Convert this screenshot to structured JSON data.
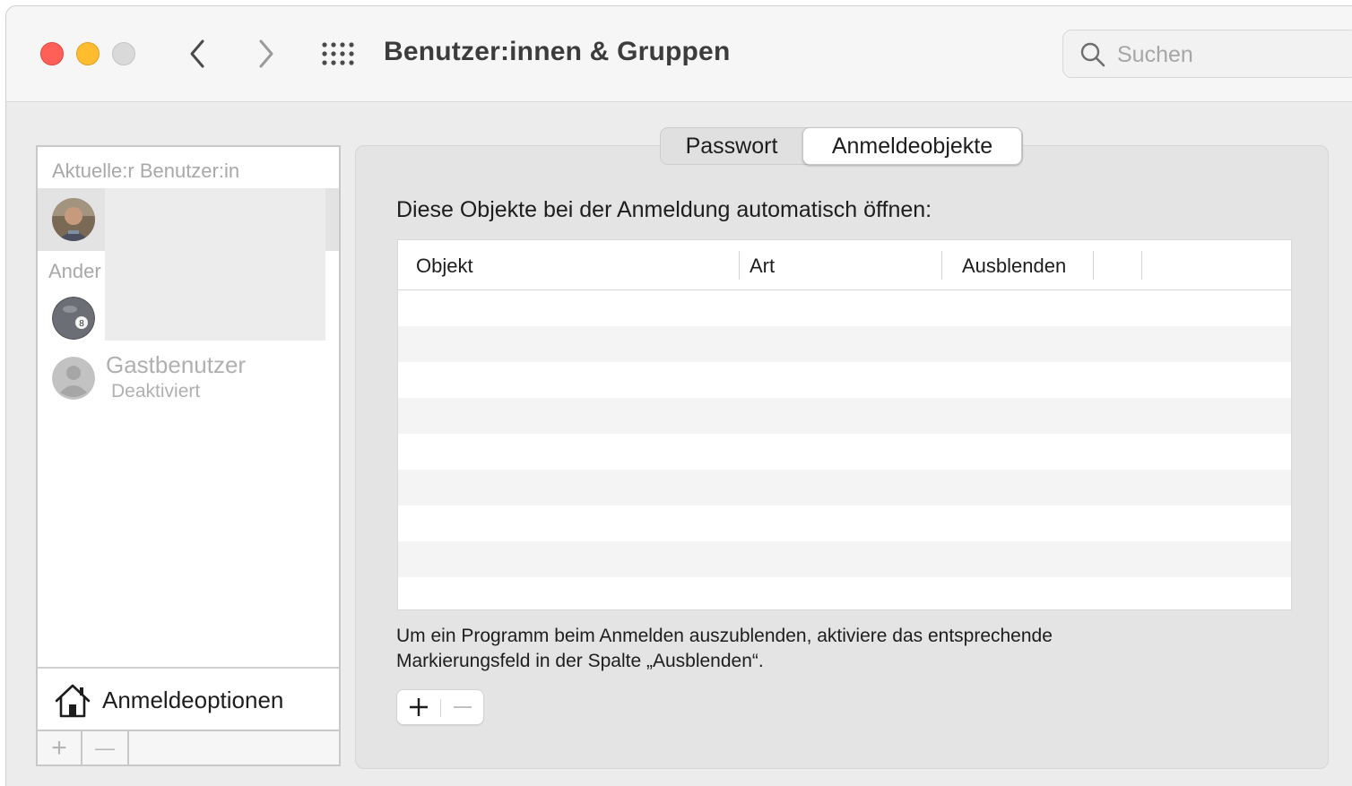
{
  "window": {
    "title": "Benutzer:innen & Gruppen"
  },
  "search": {
    "placeholder": "Suchen",
    "value": ""
  },
  "sidebar": {
    "current_user_label": "Aktuelle:r Benutzer:in",
    "other_users_label": "Ander",
    "guest": {
      "name": "Gastbenutzer",
      "status": "Deaktiviert"
    },
    "login_options_label": "Anmeldeoptionen",
    "add_symbol": "+",
    "remove_symbol": "—"
  },
  "tabs": [
    {
      "label": "Passwort",
      "selected": false
    },
    {
      "label": "Anmeldeobjekte",
      "selected": true
    }
  ],
  "login_items": {
    "heading": "Diese Objekte bei der Anmeldung automatisch öffnen:",
    "columns": [
      "Objekt",
      "Art",
      "Ausblenden"
    ],
    "rows": [],
    "help_text_line1": "Um ein Programm beim Anmelden auszublenden, aktiviere das entsprechende",
    "help_text_line2": "Markierungsfeld in der Spalte „Ausblenden“."
  },
  "colors": {
    "close": "#fe5f57",
    "minimize": "#febc2e",
    "zoom_disabled": "#d9d9d9",
    "selection": "#e3e3e3"
  }
}
